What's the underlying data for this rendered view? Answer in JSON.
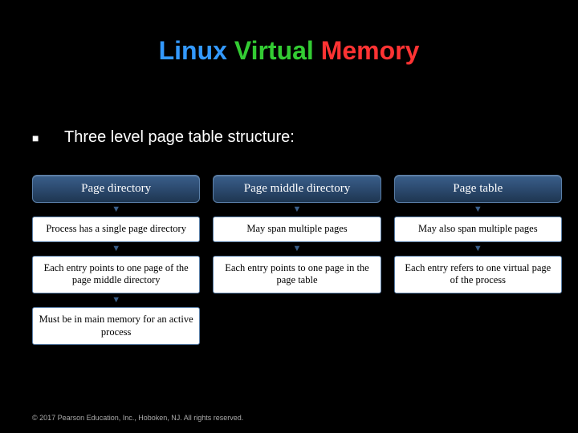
{
  "title": {
    "w1": "Linux",
    "w2": "Virtual",
    "w3": "Memory"
  },
  "bullet": {
    "mark": "■",
    "text": "Three level page table structure:"
  },
  "cols": [
    {
      "header": "Page directory",
      "rows": [
        "Process has a single page directory",
        "Each entry points to one page of the page middle directory",
        "Must be in main memory for an active process"
      ]
    },
    {
      "header": "Page middle directory",
      "rows": [
        "May span multiple pages",
        "Each entry points to one page in the page table"
      ]
    },
    {
      "header": "Page table",
      "rows": [
        "May also span multiple pages",
        "Each entry refers to one virtual page of the process"
      ]
    }
  ],
  "footer": "© 2017 Pearson Education, Inc., Hoboken, NJ. All rights reserved."
}
